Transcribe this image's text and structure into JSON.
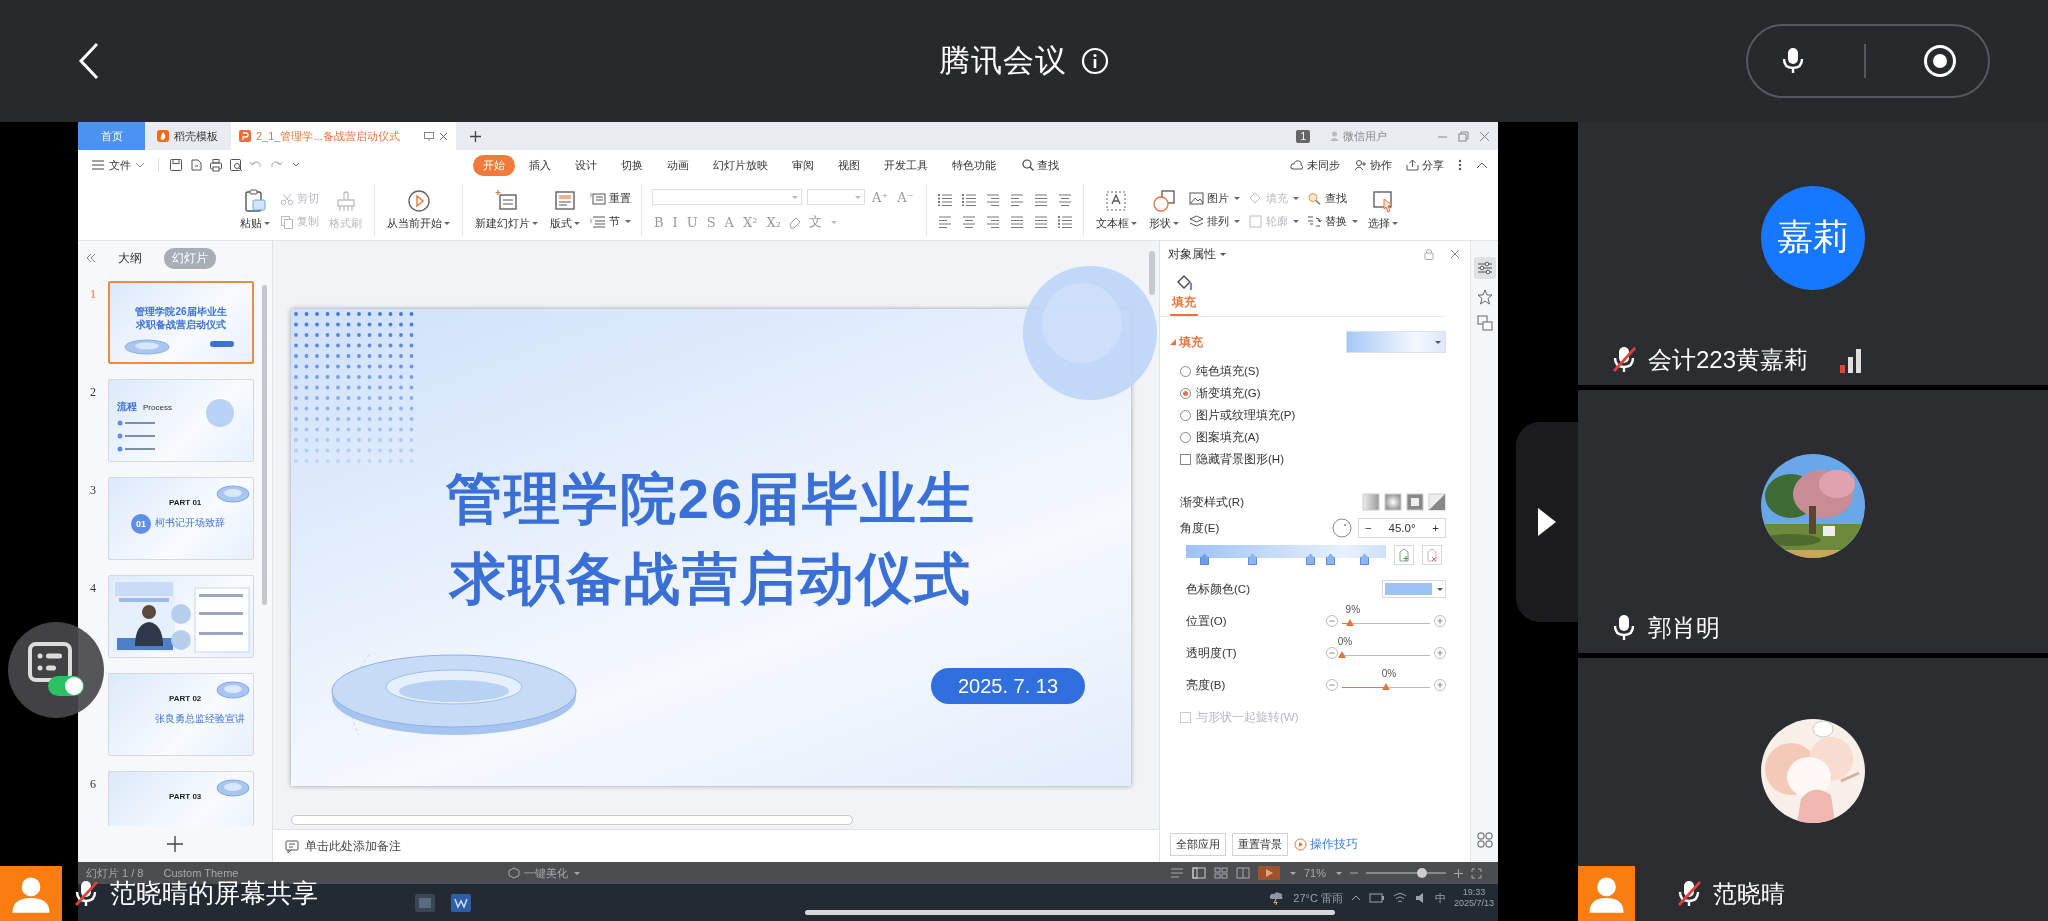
{
  "meeting": {
    "title": "腾讯会议"
  },
  "wps": {
    "tabs": [
      {
        "label": "首页",
        "kind": "home",
        "selected": false
      },
      {
        "label": "稻壳模板",
        "kind": "docer",
        "selected": false
      },
      {
        "label": "2_1_管理学...备战营启动仪式",
        "kind": "document",
        "selected": true
      }
    ],
    "account": {
      "badge": "1",
      "user": "微信用户"
    },
    "file_menu": "文件",
    "menu": [
      {
        "label": "开始",
        "selected": true
      },
      {
        "label": "插入",
        "selected": false
      },
      {
        "label": "设计",
        "selected": false
      },
      {
        "label": "切换",
        "selected": false
      },
      {
        "label": "动画",
        "selected": false
      },
      {
        "label": "幻灯片放映",
        "selected": false
      },
      {
        "label": "审阅",
        "selected": false
      },
      {
        "label": "视图",
        "selected": false
      },
      {
        "label": "开发工具",
        "selected": false
      },
      {
        "label": "特色功能",
        "selected": false
      }
    ],
    "search": "查找",
    "cloud": [
      "未同步",
      "协作",
      "分享"
    ],
    "ribbon": {
      "clipboard": [
        {
          "label": "粘贴",
          "disabled": false
        },
        {
          "label": "剪切",
          "disabled": true
        },
        {
          "label": "复制",
          "disabled": true
        },
        {
          "label": "格式刷",
          "disabled": true
        }
      ],
      "slides": [
        "从当前开始",
        "新建幻灯片",
        "版式",
        "重置",
        "节"
      ],
      "size_buttons": [
        "A⁺",
        "A⁻"
      ],
      "format_buttons": [
        "B",
        "I",
        "U",
        "S",
        "A",
        "X²",
        "X₂"
      ],
      "phonetic": "文",
      "drawing": [
        {
          "label": "文本框",
          "disabled": false
        },
        {
          "label": "形状",
          "disabled": false
        },
        {
          "label": "图片",
          "disabled": false
        },
        {
          "label": "排列",
          "disabled": false
        },
        {
          "label": "填充",
          "disabled": true
        },
        {
          "label": "轮廓",
          "disabled": true
        },
        {
          "label": "查找",
          "disabled": false
        },
        {
          "label": "替换",
          "disabled": false
        },
        {
          "label": "选择",
          "disabled": false
        }
      ]
    },
    "slide_panel": {
      "views": [
        {
          "label": "大纲",
          "selected": false
        },
        {
          "label": "幻灯片",
          "selected": true
        }
      ],
      "thumbnails": [
        {
          "number": "1",
          "kind": "title",
          "selected": true,
          "lines": [
            "管理学院26届毕业生",
            "求职备战营启动仪式"
          ]
        },
        {
          "number": "2",
          "kind": "agenda",
          "selected": false,
          "heading": "流程",
          "subheading": "Process"
        },
        {
          "number": "3",
          "kind": "section",
          "selected": false,
          "part": "PART 01",
          "index": "01",
          "title": "柯书记开场致辞"
        },
        {
          "number": "4",
          "selected": false
        },
        {
          "kind": "section",
          "selected": false,
          "part": "PART 02",
          "title": "张良勇总监经验宣讲"
        },
        {
          "number": "6",
          "kind": "section",
          "selected": false,
          "part": "PART 03"
        }
      ]
    },
    "slide": {
      "title_lines": [
        "管理学院26届毕业生",
        "求职备战营启动仪式"
      ],
      "date": "2025. 7. 13"
    },
    "notes_placeholder": "单击此处添加备注",
    "properties": {
      "title": "对象属性",
      "tabs": [
        {
          "label": "填充",
          "selected": true
        }
      ],
      "section": "填充",
      "fill_options": [
        {
          "label": "纯色填充(S)",
          "selected": false
        },
        {
          "label": "渐变填充(G)",
          "selected": true
        },
        {
          "label": "图片或纹理填充(P)",
          "selected": false
        },
        {
          "label": "图案填充(A)",
          "selected": false
        }
      ],
      "hide_background": {
        "label": "隐藏背景图形(H)",
        "checked": false
      },
      "gradient_style_label": "渐变样式(R)",
      "angle": {
        "label": "角度(E)",
        "minus": "−",
        "value": "45.0°",
        "plus": "+"
      },
      "stops": [
        {
          "level": 0.09,
          "selected": true
        },
        {
          "level": 0.33,
          "selected": false
        },
        {
          "level": 0.62,
          "selected": false
        },
        {
          "level": 0.72,
          "selected": false
        },
        {
          "level": 0.89,
          "selected": false
        }
      ],
      "stop_color_label": "色标颜色(C)",
      "sliders": [
        {
          "label": "位置(O)",
          "reading": "9%",
          "level": 0.09
        },
        {
          "label": "透明度(T)",
          "reading": "0%",
          "level": 0
        },
        {
          "label": "亮度(B)",
          "reading": "0%",
          "level": 0.5
        }
      ],
      "rotate_with_shape": {
        "label": "与形状一起旋转(W)",
        "checked": false,
        "disabled": true
      },
      "buttons": [
        "全部应用",
        "重置背景"
      ],
      "tips_link": "操作技巧"
    },
    "status": {
      "slide_count": "幻灯片 1 / 8",
      "theme": "Custom Theme",
      "beautify": "一键美化",
      "zoom": "71%",
      "zoom_slider": {
        "level": 0.7
      }
    },
    "taskbar": {
      "weather": "27°C 雷雨",
      "ime": "中",
      "time": "19:33",
      "date": "2025/7/13"
    }
  },
  "share_banner": {
    "label": "范晓晴的屏幕共享",
    "muted": true
  },
  "participants": [
    {
      "name": "会计223黄嘉莉",
      "muted": true,
      "network_icon": true,
      "presenter": false,
      "avatar": {
        "kind": "initials",
        "text": "嘉莉"
      }
    },
    {
      "name": "郭肖明",
      "muted": false,
      "network_icon": false,
      "presenter": false,
      "avatar": {
        "kind": "tree"
      }
    },
    {
      "name": "范晓晴",
      "muted": true,
      "network_icon": false,
      "presenter": true,
      "avatar": {
        "kind": "drawing"
      }
    }
  ]
}
